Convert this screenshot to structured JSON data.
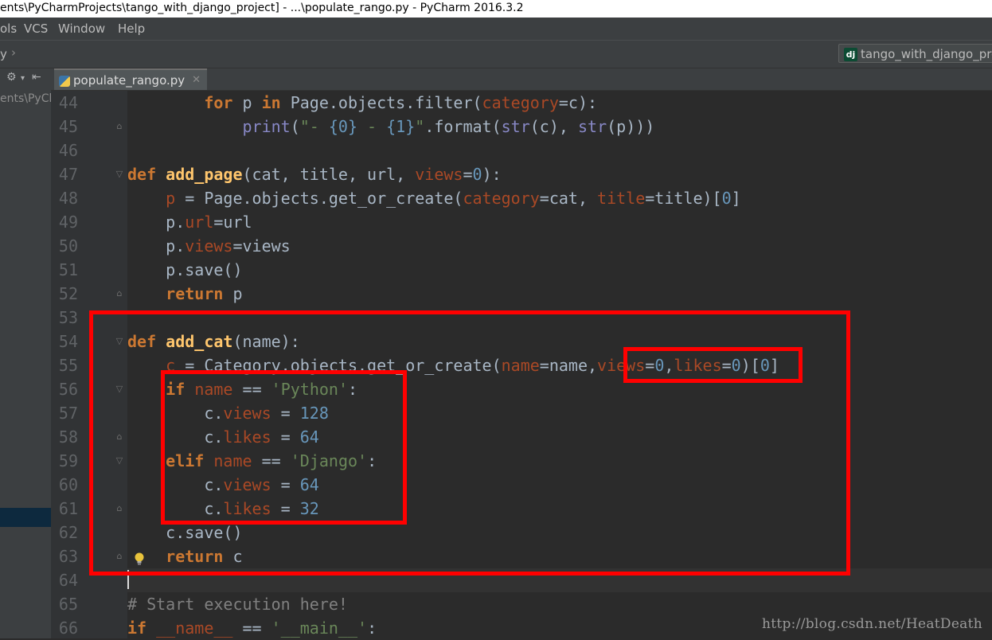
{
  "window": {
    "title": "ents\\PyCharmProjects\\tango_with_django_project] - ...\\populate_rango.py - PyCharm 2016.3.2"
  },
  "menu": {
    "items": [
      "ols",
      "VCS",
      "Window",
      "Help"
    ]
  },
  "nav": {
    "crumb": "y",
    "run_config": "tango_with_django_proj",
    "run_config_badge": "dj"
  },
  "project_panel": {
    "path": "ents\\PyCh"
  },
  "editor": {
    "tab_label": "populate_rango.py",
    "line_numbers": [
      "44",
      "45",
      "46",
      "47",
      "48",
      "49",
      "50",
      "51",
      "52",
      "53",
      "54",
      "55",
      "56",
      "57",
      "58",
      "59",
      "60",
      "61",
      "62",
      "63",
      "64",
      "65",
      "66"
    ],
    "lines": [
      "        for p in Page.objects.filter(category=c):",
      "            print(\"- {0} - {1}\".format(str(c), str(p)))",
      "",
      "def add_page(cat, title, url, views=0):",
      "    p = Page.objects.get_or_create(category=cat, title=title)[0]",
      "    p.url=url",
      "    p.views=views",
      "    p.save()",
      "    return p",
      "",
      "def add_cat(name):",
      "    c = Category.objects.get_or_create(name=name,views=0,likes=0)[0]",
      "    if name == 'Python':",
      "        c.views = 128",
      "        c.likes = 64",
      "    elif name == 'Django':",
      "        c.views = 64",
      "        c.likes = 32",
      "    c.save()",
      "    return c",
      "",
      "# Start execution here!",
      "if __name__ == '__main__':"
    ]
  },
  "watermark": "http://blog.csdn.net/HeatDeath",
  "colors": {
    "highlight_box": "#ff0000",
    "editor_bg": "#2b2b2b",
    "keyword": "#cc7832",
    "string": "#6a8759",
    "number": "#6897bb"
  }
}
